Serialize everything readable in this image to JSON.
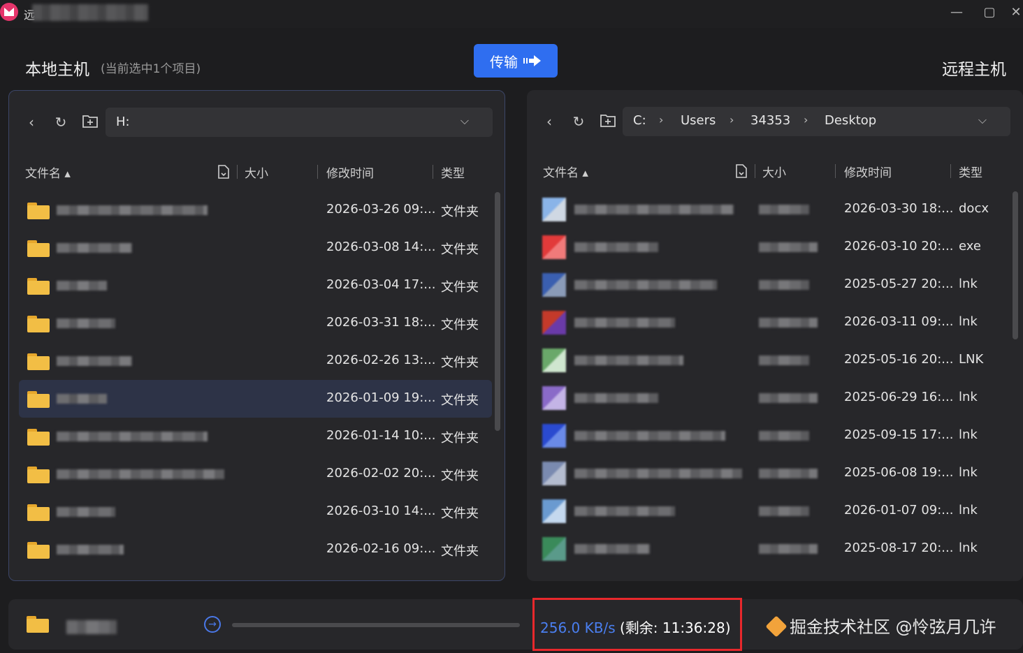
{
  "window": {
    "title": "远"
  },
  "header": {
    "local_title": "本地主机",
    "local_subtitle": "(当前选中1个项目)",
    "transfer_label": "传输",
    "remote_title": "远程主机"
  },
  "local": {
    "path": "H:",
    "columns": {
      "name": "文件名",
      "size": "大小",
      "modified": "修改时间",
      "type": "类型"
    },
    "rows": [
      {
        "modified": "2026-03-26 09:...",
        "type": "文件夹"
      },
      {
        "modified": "2026-03-08 14:...",
        "type": "文件夹"
      },
      {
        "modified": "2026-03-04 17:...",
        "type": "文件夹"
      },
      {
        "modified": "2026-03-31 18:...",
        "type": "文件夹"
      },
      {
        "modified": "2026-02-26 13:...",
        "type": "文件夹"
      },
      {
        "modified": "2026-01-09 19:...",
        "type": "文件夹"
      },
      {
        "modified": "2026-01-14 10:...",
        "type": "文件夹"
      },
      {
        "modified": "2026-02-02 20:...",
        "type": "文件夹"
      },
      {
        "modified": "2026-03-10 14:...",
        "type": "文件夹"
      },
      {
        "modified": "2026-02-16 09:...",
        "type": "文件夹"
      }
    ]
  },
  "remote": {
    "breadcrumb": [
      "C:",
      "Users",
      "34353",
      "Desktop"
    ],
    "columns": {
      "name": "文件名",
      "size": "大小",
      "modified": "修改时间",
      "type": "类型"
    },
    "rows": [
      {
        "modified": "2026-03-30 18:...",
        "type": "docx"
      },
      {
        "modified": "2026-03-10 20:...",
        "type": "exe"
      },
      {
        "modified": "2025-05-27 20:...",
        "type": "lnk"
      },
      {
        "modified": "2026-03-11 09:...",
        "type": "lnk"
      },
      {
        "modified": "2025-05-16 20:...",
        "type": "LNK"
      },
      {
        "modified": "2025-06-29 16:...",
        "type": "lnk"
      },
      {
        "modified": "2025-09-15 17:...",
        "type": "lnk"
      },
      {
        "modified": "2025-06-08 19:...",
        "type": "lnk"
      },
      {
        "modified": "2026-01-07 09:...",
        "type": "lnk"
      },
      {
        "modified": "2025-08-17 20:...",
        "type": "lnk"
      }
    ]
  },
  "transfer_status": {
    "speed": "256.0 KB/s",
    "remaining": "(剩余:  11:36:28)",
    "progress": 0
  },
  "watermark": "掘金技术社区 @怜弦月几许",
  "colors": {
    "accent": "#2f6ef0",
    "highlight": "#e8282c",
    "folder": "#f2be45"
  }
}
